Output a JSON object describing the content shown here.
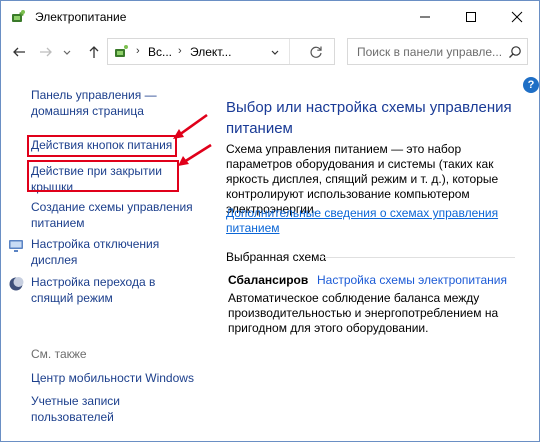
{
  "window": {
    "title": "Электропитание",
    "icons": {
      "app": "power-options-icon",
      "minimize": "minimize-icon",
      "maximize": "maximize-icon",
      "close": "close-icon"
    }
  },
  "nav": {
    "breadcrumb_1": "Вс...",
    "breadcrumb_2": "Элект...",
    "search_placeholder": "Поиск в панели управле...",
    "icons": {
      "back": "arrow-left-icon",
      "forward": "arrow-right-icon",
      "recent": "chevron-down-icon",
      "up": "arrow-up-icon",
      "refresh": "refresh-icon",
      "search": "search-icon"
    }
  },
  "help": {
    "label": "?"
  },
  "sidebar": {
    "home_link": "Панель управления — домашняя страница",
    "power_buttons_link": "Действия кнопок питания",
    "lid_link": "Действие при закрытии крышки",
    "create_plan_link": "Создание схемы управления питанием",
    "display_off_link": "Настройка отключения дисплея",
    "sleep_link": "Настройка перехода в спящий режим",
    "see_also": "См. также",
    "mobility_link": "Центр мобильности Windows",
    "accounts_link": "Учетные записи пользователей"
  },
  "main": {
    "heading": "Выбор или настройка схемы управления питанием",
    "description": "Схема управления питанием — это набор параметров оборудования и системы (таких как яркость дисплея, спящий режим и т. д.), которые контролируют использование компьютером электроэнергии.",
    "more_link": "Дополнительные сведения о схемах управления питанием",
    "selected_plan_label": "Выбранная схема",
    "plan_name": "Сбалансиров",
    "plan_settings_link": "Настройка схемы электропитания",
    "plan_description": "Автоматическое соблюдение баланса между производительностью и энергопотреблением на пригодном для этого оборудовании."
  },
  "annotations": {
    "highlight_color": "#e0001a"
  }
}
